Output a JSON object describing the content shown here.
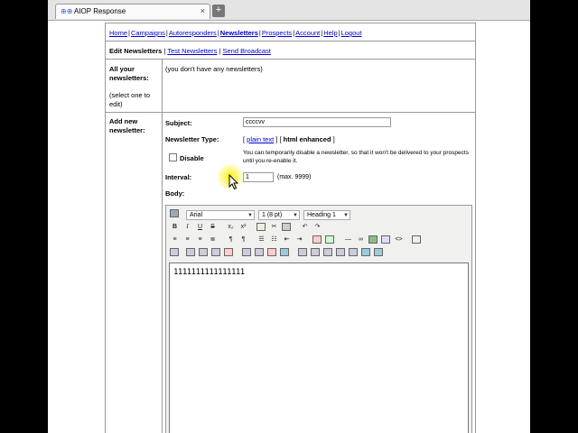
{
  "browser": {
    "tab_title": "AIOP Response",
    "tab_close": "×",
    "new_tab": "+"
  },
  "navbar": {
    "items": [
      "Home",
      "Campaigns",
      "Autoresponders",
      "Newsletters",
      "Prospects",
      "Account",
      "Help",
      "Logout"
    ],
    "active": "Newsletters"
  },
  "subnav": {
    "current": "Edit Newsletters",
    "links": [
      "Test Newsletters",
      "Send Broadcast"
    ]
  },
  "all_newsletters": {
    "label": "All your newsletters:",
    "hint": "(select one to edit)",
    "empty_text": "(you don't have any newsletters)"
  },
  "new_newsletter": {
    "label": "Add new newsletter:",
    "subject_label": "Subject:",
    "subject_value": "ccccvv",
    "type_label": "Newsletter Type:",
    "type_plain": "plain text",
    "type_html": "html enhanced",
    "disable_label": "Disable",
    "disable_help": "You can temporarily disable a newsletter, so that it won't be delivered to your prospects until you re-enable it.",
    "interval_label": "Interval:",
    "interval_value": "1",
    "interval_hint": "(max. 9999)",
    "body_label": "Body:"
  },
  "editor": {
    "font_family": "Arial",
    "font_size": "1 (8 pt)",
    "format": "Heading 1",
    "content": "1111111111111111"
  }
}
